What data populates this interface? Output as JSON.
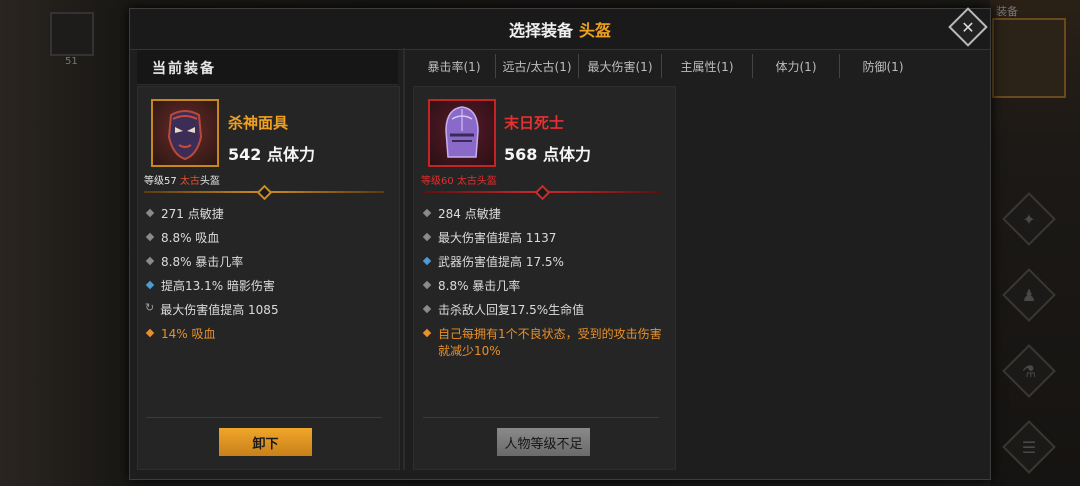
{
  "window": {
    "title": "选择装备",
    "title_accent": "头盔"
  },
  "left_section": {
    "header": "当前装备"
  },
  "tabs": [
    "暴击率(1)",
    "远古/太古(1)",
    "最大伤害(1)",
    "主属性(1)",
    "体力(1)",
    "防御(1)"
  ],
  "current_item": {
    "name": "杀神面具",
    "stat": "542 点体力",
    "level_prefix": "等级57 ",
    "rarity": "太古",
    "slot": "头盔",
    "attributes": [
      {
        "bullet": "gray",
        "text": "271 点敏捷"
      },
      {
        "bullet": "gray",
        "text": "8.8% 吸血"
      },
      {
        "bullet": "gray",
        "text": "8.8% 暴击几率"
      },
      {
        "bullet": "blue",
        "text": "提高13.1% 暗影伤害"
      },
      {
        "bullet": "cycle",
        "text": "最大伤害值提高 1085"
      },
      {
        "bullet": "orange",
        "text": "14% 吸血"
      }
    ],
    "button": "卸下",
    "colors": {
      "name": "#f0a020",
      "frame": "#c8861e",
      "bar": "#c8861e"
    }
  },
  "compare_item": {
    "name": "末日死士",
    "stat": "568 点体力",
    "level_text": "等级60 太古头盔",
    "attributes": [
      {
        "bullet": "gray",
        "text": "284 点敏捷"
      },
      {
        "bullet": "gray",
        "text": "最大伤害值提高 1137"
      },
      {
        "bullet": "blue",
        "text": "武器伤害值提高 17.5%"
      },
      {
        "bullet": "gray",
        "text": "8.8% 暴击几率"
      },
      {
        "bullet": "gray",
        "text": "击杀敌人回复17.5%生命值"
      },
      {
        "bullet": "orange",
        "text": "自己每拥有1个不良状态，受到的攻击伤害就减少10%"
      }
    ],
    "button": "人物等级不足",
    "colors": {
      "name": "#e83030",
      "frame": "#c42424",
      "bar": "#c42424"
    }
  },
  "background": {
    "left_box_number": "51",
    "right_title": "装备"
  }
}
